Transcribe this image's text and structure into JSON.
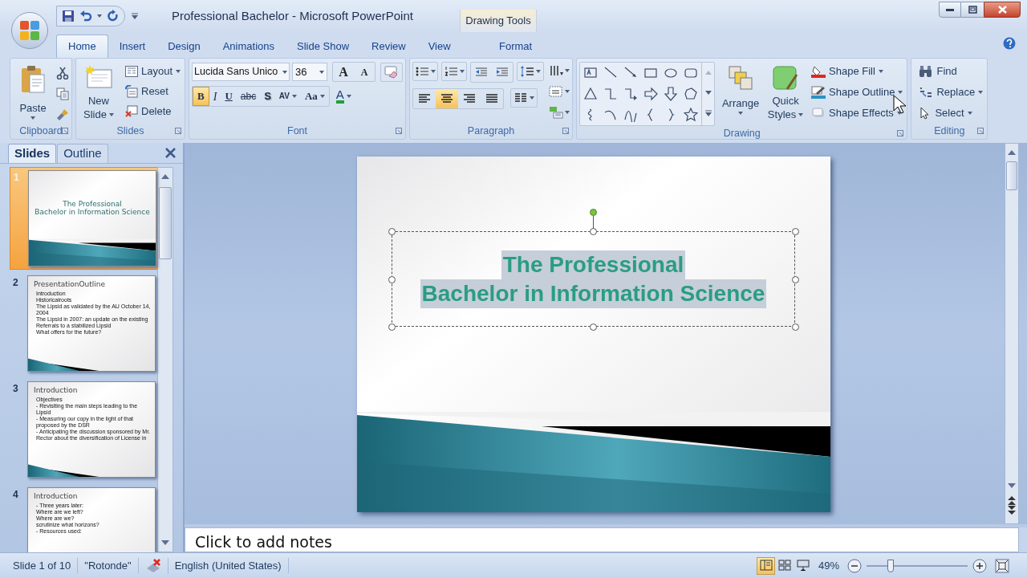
{
  "window": {
    "title": "Professional Bachelor - Microsoft PowerPoint",
    "contextual_tab": "Drawing Tools"
  },
  "tabs": [
    {
      "label": "Home",
      "selected": true
    },
    {
      "label": "Insert",
      "selected": false
    },
    {
      "label": "Design",
      "selected": false
    },
    {
      "label": "Animations",
      "selected": false
    },
    {
      "label": "Slide Show",
      "selected": false
    },
    {
      "label": "Review",
      "selected": false
    },
    {
      "label": "View",
      "selected": false
    },
    {
      "label": "Format",
      "selected": false
    }
  ],
  "ribbon": {
    "clipboard": {
      "label": "Clipboard",
      "paste": "Paste"
    },
    "slides": {
      "label": "Slides",
      "new_slide": [
        "New",
        "Slide"
      ],
      "buttons": [
        "Layout",
        "Reset",
        "Delete"
      ]
    },
    "font": {
      "label": "Font",
      "font_name": "Lucida Sans Unico",
      "font_size": "36",
      "size_buttons": [
        "A",
        "A"
      ],
      "format_buttons": [
        {
          "kind": "bold",
          "label": "B",
          "selected": true
        },
        {
          "kind": "italic",
          "label": "I",
          "selected": false
        },
        {
          "kind": "underline",
          "label": "U",
          "selected": false
        },
        {
          "kind": "strike",
          "label": "abc",
          "selected": false
        },
        {
          "kind": "shadow",
          "label": "S",
          "selected": false
        },
        {
          "kind": "spacing",
          "label": "AV",
          "selected": false
        },
        {
          "kind": "case",
          "label": "Aa",
          "selected": false
        },
        {
          "kind": "color",
          "label": "A",
          "selected": false
        }
      ]
    },
    "paragraph": {
      "label": "Paragraph",
      "alignments": [
        {
          "kind": "left",
          "selected": false
        },
        {
          "kind": "center",
          "selected": true
        },
        {
          "kind": "right",
          "selected": false
        },
        {
          "kind": "justify",
          "selected": false
        }
      ]
    },
    "drawing": {
      "label": "Drawing",
      "arrange": "Arrange",
      "quick_styles": [
        "Quick",
        "Styles"
      ],
      "buttons": [
        "Shape Fill",
        "Shape Outline",
        "Shape Effects"
      ]
    },
    "editing": {
      "label": "Editing",
      "buttons": [
        "Find",
        "Replace",
        "Select"
      ]
    }
  },
  "slides_pane": {
    "tabs": [
      {
        "label": "Slides",
        "selected": true
      },
      {
        "label": "Outline",
        "selected": false
      }
    ],
    "thumbnails": [
      {
        "number": "1",
        "selected": true,
        "kind": "title",
        "title": [
          "The Professional",
          "Bachelor in Information Science"
        ]
      },
      {
        "number": "2",
        "selected": false,
        "kind": "content",
        "title": [
          "PresentationOutline"
        ],
        "lines": [
          "Introduction",
          "Historicalroots",
          "The Lipsid as validated by the AU October 14, 2004",
          "The Lipsid in 2007: an update on the existing",
          "Referrals to a stabilized Lipsid",
          "What offers for the future?"
        ]
      },
      {
        "number": "3",
        "selected": false,
        "kind": "content",
        "title": [
          "Introduction"
        ],
        "lines": [
          "Objectives",
          "- Revisiting the main steps leading to the Lipsid",
          "- Measuring our copy in the light of that proposed by the DSR",
          "- Anticipating the discussion sponsored by Mr. Rector about the diversification of License in"
        ]
      },
      {
        "number": "4",
        "selected": false,
        "kind": "content",
        "title": [
          "Introduction"
        ],
        "lines": [
          "- Three years later:",
          "Where are we left?",
          "Where are we?",
          "scrutinize what horizons?",
          "- Resources used:"
        ]
      }
    ]
  },
  "slide": {
    "title": [
      "The Professional",
      "Bachelor in Information Science"
    ],
    "text_selected": true
  },
  "notes": {
    "placeholder": "Click to add notes"
  },
  "status_bar": {
    "slide": "Slide 1 of 10",
    "theme": "\"Rotonde\"",
    "language": "English (United States)",
    "views": [
      {
        "kind": "normal",
        "selected": true
      },
      {
        "kind": "sorter",
        "selected": false
      },
      {
        "kind": "show",
        "selected": false
      }
    ],
    "zoom": {
      "label": "49%",
      "level": 0.22
    }
  }
}
